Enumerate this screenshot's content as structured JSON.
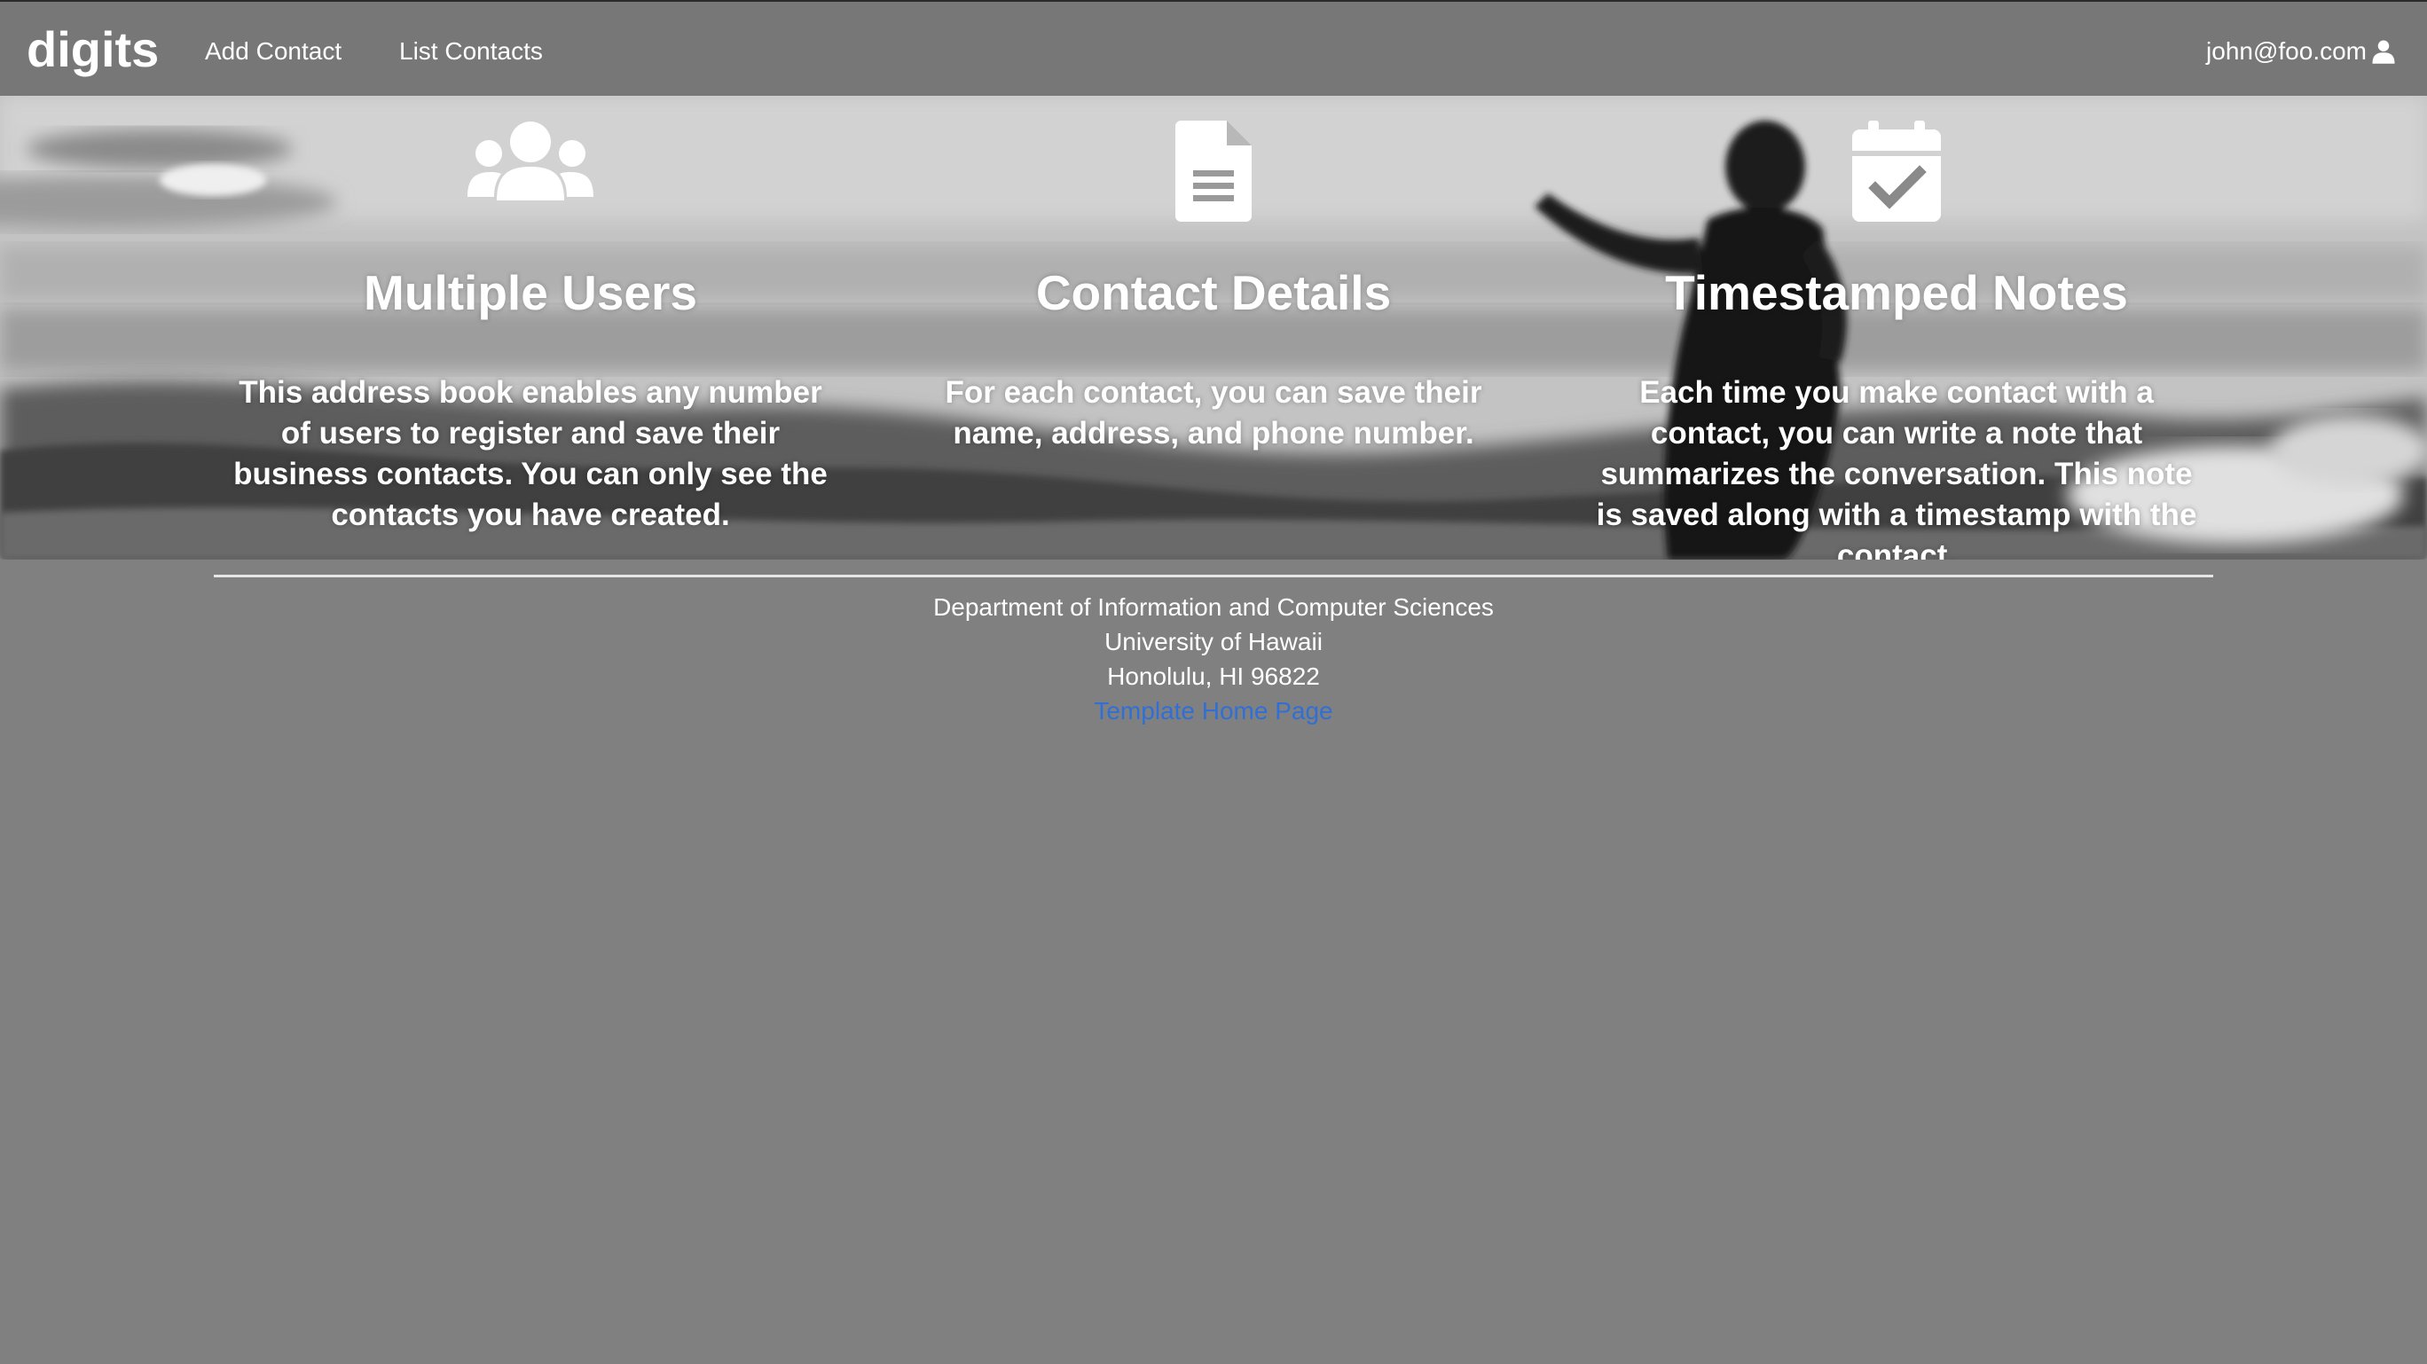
{
  "navbar": {
    "brand": "digits",
    "links": [
      {
        "label": "Add Contact"
      },
      {
        "label": "List Contacts"
      }
    ],
    "user": {
      "email": "john@foo.com",
      "icon": "user-icon"
    }
  },
  "features": [
    {
      "icon": "users-icon",
      "title": "Multiple Users",
      "description": "This address book enables any number of users to register and save their business contacts. You can only see the contacts you have created."
    },
    {
      "icon": "file-text-icon",
      "title": "Contact Details",
      "description": "For each contact, you can save their name, address, and phone number."
    },
    {
      "icon": "calendar-check-icon",
      "title": "Timestamped Notes",
      "description": "Each time you make contact with a contact, you can write a note that summarizes the conversation. This note is saved along with a timestamp with the contact."
    }
  ],
  "footer": {
    "lines": [
      "Department of Information and Computer Sciences",
      "University of Hawaii",
      "Honolulu, HI 96822"
    ],
    "link_label": "Template Home Page"
  }
}
